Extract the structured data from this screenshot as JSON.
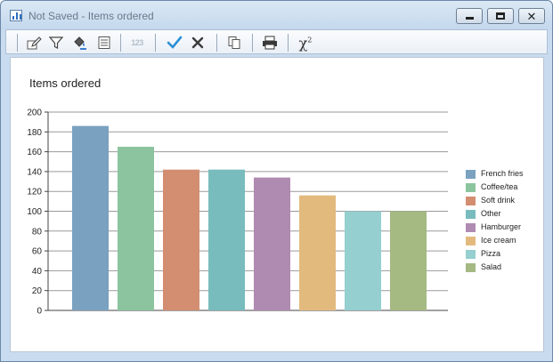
{
  "window": {
    "title": "Not Saved - Items ordered",
    "app_icon": "bar-chart-icon",
    "controls": [
      {
        "name": "minimize",
        "icon": "minimize-icon"
      },
      {
        "name": "maximize",
        "icon": "maximize-icon"
      },
      {
        "name": "close",
        "icon": "close-icon",
        "label": "✕"
      }
    ]
  },
  "toolbar": {
    "items": [
      {
        "name": "edit-data",
        "icon": "edit-pencil-icon"
      },
      {
        "name": "filter",
        "icon": "filter-icon"
      },
      {
        "name": "fill-color",
        "icon": "paint-bucket-icon"
      },
      {
        "name": "properties",
        "icon": "document-list-icon"
      },
      {
        "name": "number-format",
        "icon": "number-format-icon",
        "label": "123",
        "disabled": true
      },
      {
        "name": "apply",
        "icon": "checkmark-icon"
      },
      {
        "name": "cancel",
        "icon": "x-icon"
      },
      {
        "name": "copy",
        "icon": "copy-icon"
      },
      {
        "name": "print",
        "icon": "printer-icon"
      },
      {
        "name": "chi-square",
        "icon": "chi-square-icon",
        "label": "χ",
        "superscript": "2"
      }
    ]
  },
  "chart_data": {
    "type": "bar",
    "title": "Items ordered",
    "xlabel": "",
    "ylabel": "",
    "ylim": [
      0,
      200
    ],
    "yticks": [
      0,
      20,
      40,
      60,
      80,
      100,
      120,
      140,
      160,
      180,
      200
    ],
    "grid": true,
    "legend_position": "right",
    "categories": [
      "French fries",
      "Coffee/tea",
      "Soft drink",
      "Other",
      "Hamburger",
      "Ice cream",
      "Pizza",
      "Salad"
    ],
    "values": [
      186,
      165,
      142,
      142,
      134,
      116,
      100,
      100
    ],
    "colors": [
      "#7aa1c0",
      "#8bc49e",
      "#d38e72",
      "#78bcbd",
      "#b08bb1",
      "#e3ba7e",
      "#95cfcf",
      "#a5b982"
    ]
  }
}
